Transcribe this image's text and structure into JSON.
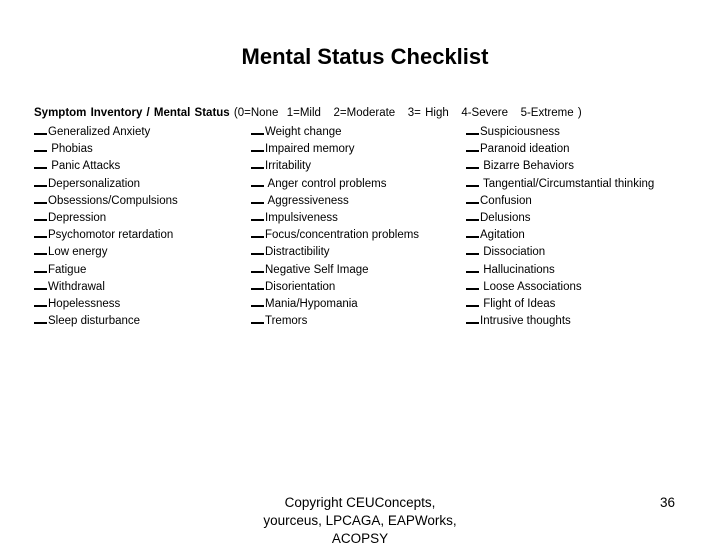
{
  "title": "Mental Status Checklist",
  "header": {
    "label": "Symptom Inventory / Mental Status",
    "scale": "(0=None  1=Mild   2=Moderate   3= High   4-Severe   5-Extreme )"
  },
  "columns": [
    {
      "items": [
        {
          "blank": "__",
          "label": "Generalized Anxiety"
        },
        {
          "blank": "__",
          "label": " Phobias"
        },
        {
          "blank": "__",
          "label": " Panic Attacks"
        },
        {
          "blank": "__",
          "label": "Depersonalization"
        },
        {
          "blank": "__",
          "label": "Obsessions/Compulsions"
        },
        {
          "blank": "__",
          "label": "Depression"
        },
        {
          "blank": "__",
          "label": "Psychomotor retardation"
        },
        {
          "blank": "__",
          "label": "Low energy"
        },
        {
          "blank": "__",
          "label": "Fatigue"
        },
        {
          "blank": "__",
          "label": "Withdrawal"
        },
        {
          "blank": "__",
          "label": "Hopelessness"
        },
        {
          "blank": "__",
          "label": "Sleep disturbance"
        }
      ]
    },
    {
      "items": [
        {
          "blank": "__",
          "label": "Weight change"
        },
        {
          "blank": "__",
          "label": "Impaired memory"
        },
        {
          "blank": "__",
          "label": "Irritability"
        },
        {
          "blank": "__",
          "label": " Anger control problems"
        },
        {
          "blank": "__",
          "label": " Aggressiveness"
        },
        {
          "blank": "__",
          "label": "Impulsiveness"
        },
        {
          "blank": "__",
          "label": "Focus/concentration problems"
        },
        {
          "blank": "__",
          "label": "Distractibility"
        },
        {
          "blank": "__",
          "label": "Negative Self Image"
        },
        {
          "blank": "__",
          "label": "Disorientation"
        },
        {
          "blank": "__",
          "label": "Mania/Hypomania"
        },
        {
          "blank": "__",
          "label": "Tremors"
        }
      ]
    },
    {
      "items": [
        {
          "blank": "__",
          "label": "Suspiciousness"
        },
        {
          "blank": "__",
          "label": "Paranoid ideation"
        },
        {
          "blank": "__",
          "label": " Bizarre Behaviors"
        },
        {
          "blank": "__",
          "label": " Tangential/Circumstantial thinking"
        },
        {
          "blank": "__",
          "label": "Confusion"
        },
        {
          "blank": "__",
          "label": "Delusions"
        },
        {
          "blank": "__",
          "label": "Agitation"
        },
        {
          "blank": "__",
          "label": " Dissociation"
        },
        {
          "blank": "__",
          "label": " Hallucinations"
        },
        {
          "blank": "__",
          "label": " Loose Associations"
        },
        {
          "blank": "__",
          "label": " Flight of Ideas"
        },
        {
          "blank": "__",
          "label": "Intrusive thoughts"
        }
      ]
    }
  ],
  "footer": {
    "copyright_line1": "Copyright CEUConcepts,",
    "copyright_line2": "yourceus, LPCAGA, EAPWorks,",
    "copyright_line3": "ACOPSY",
    "page_number": "36"
  }
}
